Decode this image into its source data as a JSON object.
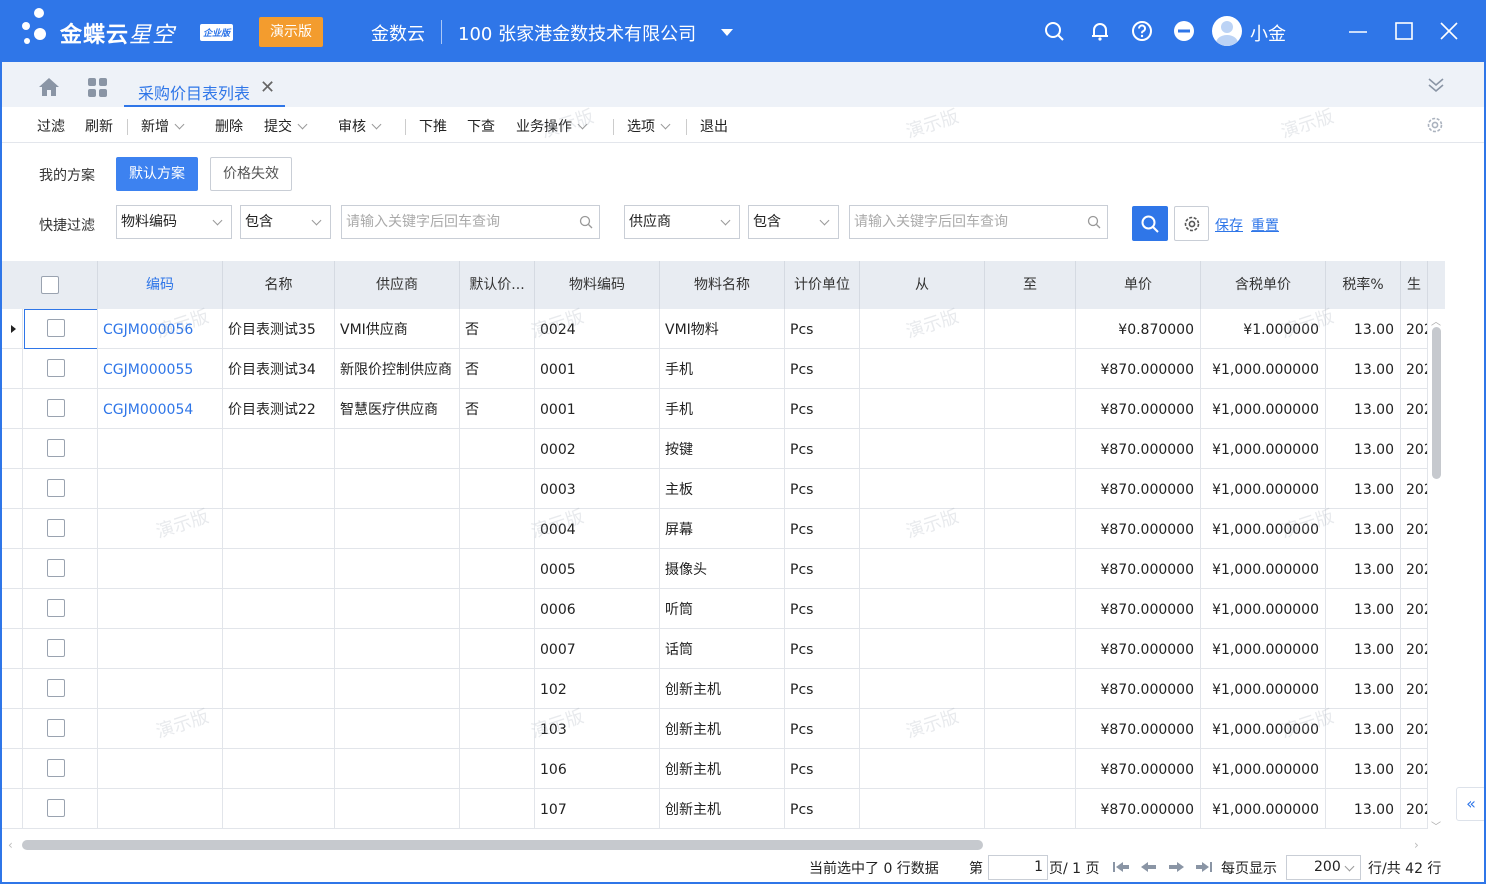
{
  "titlebar": {
    "brand": "金蝶云",
    "brand_sub": "星空",
    "edition_badge": "企业版",
    "demo_badge": "演示版",
    "product": "金数云",
    "org": "100  张家港金数技术有限公司",
    "username": "小金",
    "icons": [
      "search-icon",
      "bell-icon",
      "help-icon",
      "minus-circle-icon",
      "avatar",
      "minimize-icon",
      "maximize-icon",
      "close-icon"
    ]
  },
  "tabs": {
    "active_label": "采购价目表列表",
    "close_glyph": "✕"
  },
  "toolbar": {
    "filter": "过滤",
    "refresh": "刷新",
    "add": "新增",
    "delete": "删除",
    "submit": "提交",
    "audit": "审核",
    "push_down": "下推",
    "query_down": "下查",
    "biz_ops": "业务操作",
    "options": "选项",
    "exit": "退出"
  },
  "filter": {
    "my_scheme_label": "我的方案",
    "default_scheme": "默认方案",
    "price_invalid": "价格失效",
    "quick_filter_label": "快捷过滤",
    "field1": "物料编码",
    "op1": "包含",
    "placeholder1": "请输入关键字后回车查询",
    "field2": "供应商",
    "op2": "包含",
    "placeholder2": "请输入关键字后回车查询",
    "save": "保存",
    "reset": "重置"
  },
  "grid": {
    "columns": [
      "编码",
      "名称",
      "供应商",
      "默认价...",
      "物料编码",
      "物料名称",
      "计价单位",
      "从",
      "至",
      "单价",
      "含税单价",
      "税率%",
      "生"
    ],
    "rows": [
      {
        "code": "CGJM000056",
        "name": "价目表测试35",
        "supplier": "VMI供应商",
        "default": "否",
        "mat_code": "0024",
        "mat_name": "VMI物料",
        "unit": "Pcs",
        "from": "",
        "to": "",
        "price": "¥0.870000",
        "tax_price": "¥1.000000",
        "tax_rate": "13.00",
        "prod": "202"
      },
      {
        "code": "CGJM000055",
        "name": "价目表测试34",
        "supplier": "新限价控制供应商",
        "default": "否",
        "mat_code": "0001",
        "mat_name": "手机",
        "unit": "Pcs",
        "from": "",
        "to": "",
        "price": "¥870.000000",
        "tax_price": "¥1,000.000000",
        "tax_rate": "13.00",
        "prod": "202"
      },
      {
        "code": "CGJM000054",
        "name": "价目表测试22",
        "supplier": "智慧医疗供应商",
        "default": "否",
        "mat_code": "0001",
        "mat_name": "手机",
        "unit": "Pcs",
        "from": "",
        "to": "",
        "price": "¥870.000000",
        "tax_price": "¥1,000.000000",
        "tax_rate": "13.00",
        "prod": "202"
      },
      {
        "code": "",
        "name": "",
        "supplier": "",
        "default": "",
        "mat_code": "0002",
        "mat_name": "按键",
        "unit": "Pcs",
        "from": "",
        "to": "",
        "price": "¥870.000000",
        "tax_price": "¥1,000.000000",
        "tax_rate": "13.00",
        "prod": "202"
      },
      {
        "code": "",
        "name": "",
        "supplier": "",
        "default": "",
        "mat_code": "0003",
        "mat_name": "主板",
        "unit": "Pcs",
        "from": "",
        "to": "",
        "price": "¥870.000000",
        "tax_price": "¥1,000.000000",
        "tax_rate": "13.00",
        "prod": "202"
      },
      {
        "code": "",
        "name": "",
        "supplier": "",
        "default": "",
        "mat_code": "0004",
        "mat_name": "屏幕",
        "unit": "Pcs",
        "from": "",
        "to": "",
        "price": "¥870.000000",
        "tax_price": "¥1,000.000000",
        "tax_rate": "13.00",
        "prod": "202"
      },
      {
        "code": "",
        "name": "",
        "supplier": "",
        "default": "",
        "mat_code": "0005",
        "mat_name": "摄像头",
        "unit": "Pcs",
        "from": "",
        "to": "",
        "price": "¥870.000000",
        "tax_price": "¥1,000.000000",
        "tax_rate": "13.00",
        "prod": "202"
      },
      {
        "code": "",
        "name": "",
        "supplier": "",
        "default": "",
        "mat_code": "0006",
        "mat_name": "听筒",
        "unit": "Pcs",
        "from": "",
        "to": "",
        "price": "¥870.000000",
        "tax_price": "¥1,000.000000",
        "tax_rate": "13.00",
        "prod": "202"
      },
      {
        "code": "",
        "name": "",
        "supplier": "",
        "default": "",
        "mat_code": "0007",
        "mat_name": "话筒",
        "unit": "Pcs",
        "from": "",
        "to": "",
        "price": "¥870.000000",
        "tax_price": "¥1,000.000000",
        "tax_rate": "13.00",
        "prod": "202"
      },
      {
        "code": "",
        "name": "",
        "supplier": "",
        "default": "",
        "mat_code": "102",
        "mat_name": "创新主机",
        "unit": "Pcs",
        "from": "",
        "to": "",
        "price": "¥870.000000",
        "tax_price": "¥1,000.000000",
        "tax_rate": "13.00",
        "prod": "202"
      },
      {
        "code": "",
        "name": "",
        "supplier": "",
        "default": "",
        "mat_code": "103",
        "mat_name": "创新主机",
        "unit": "Pcs",
        "from": "",
        "to": "",
        "price": "¥870.000000",
        "tax_price": "¥1,000.000000",
        "tax_rate": "13.00",
        "prod": "202"
      },
      {
        "code": "",
        "name": "",
        "supplier": "",
        "default": "",
        "mat_code": "106",
        "mat_name": "创新主机",
        "unit": "Pcs",
        "from": "",
        "to": "",
        "price": "¥870.000000",
        "tax_price": "¥1,000.000000",
        "tax_rate": "13.00",
        "prod": "202"
      },
      {
        "code": "",
        "name": "",
        "supplier": "",
        "default": "",
        "mat_code": "107",
        "mat_name": "创新主机",
        "unit": "Pcs",
        "from": "",
        "to": "",
        "price": "¥870.000000",
        "tax_price": "¥1,000.000000",
        "tax_rate": "13.00",
        "prod": "202"
      }
    ]
  },
  "footer": {
    "selected": "当前选中了 0 行数据",
    "page_prefix": "第",
    "page_num": "1",
    "page_suffix": "页/ 1 页",
    "per_page_label": "每页显示",
    "per_page": "200",
    "total": "行/共 42 行"
  },
  "watermark": "演示版",
  "colors": {
    "primary": "#2f76e8",
    "demo_badge": "#f39c2e",
    "header_bg": "#e8ecf2"
  }
}
